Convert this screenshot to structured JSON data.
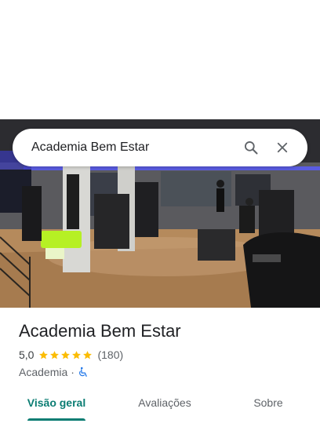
{
  "search": {
    "query": "Academia Bem Estar"
  },
  "place": {
    "name": "Academia Bem Estar",
    "rating": "5,0",
    "stars": 5,
    "reviews": "(180)",
    "category": "Academia",
    "separator": "·"
  },
  "tabs": [
    {
      "label": "Visão geral",
      "active": true
    },
    {
      "label": "Avaliações",
      "active": false
    },
    {
      "label": "Sobre",
      "active": false
    }
  ],
  "colors": {
    "accent": "#0b7d73",
    "star": "#fbbc04",
    "accessibility": "#1a73e8"
  },
  "icons": [
    "search-icon",
    "close-icon",
    "star-icon",
    "wheelchair-icon"
  ]
}
